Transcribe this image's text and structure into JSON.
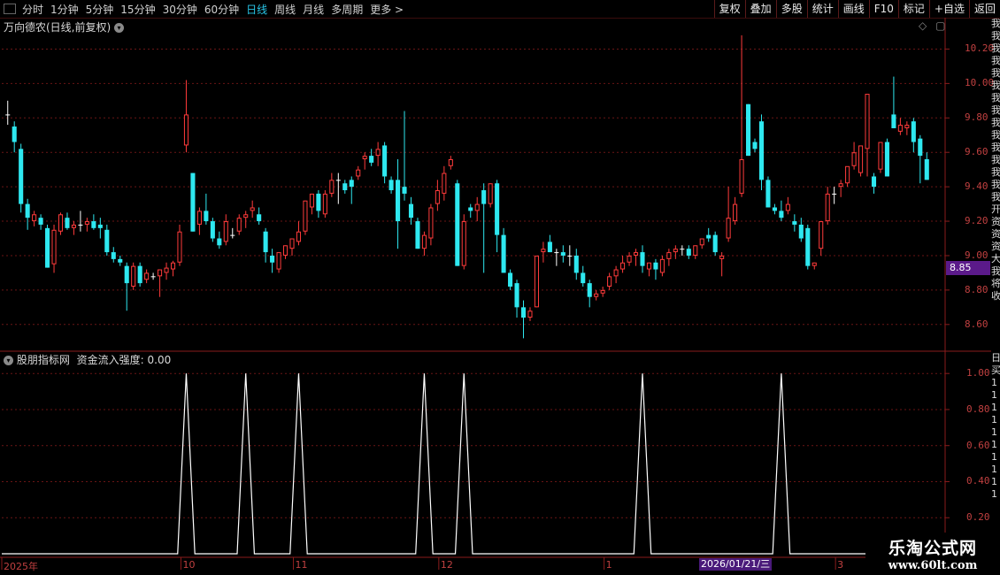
{
  "toolbar": {
    "periods": [
      "分时",
      "1分钟",
      "5分钟",
      "15分钟",
      "30分钟",
      "60分钟",
      "日线",
      "周线",
      "月线",
      "多周期",
      "更多 >"
    ],
    "active_period": "日线",
    "tools": [
      "复权",
      "叠加",
      "多股",
      "统计",
      "画线",
      "F10",
      "标记",
      "+自选",
      "返回"
    ]
  },
  "main_pane": {
    "title": "万向德农(日线,前复权)",
    "price_ticks": [
      "10.20",
      "10.00",
      "9.80",
      "9.60",
      "9.40",
      "9.20",
      "9.00",
      "8.80",
      "8.60"
    ],
    "current_price_tag": "8.85",
    "right_strip_chars": [
      "我",
      "我",
      "我",
      "我",
      "我",
      "我",
      "我",
      "我",
      "我",
      "我",
      "我",
      "我",
      "我",
      "我",
      "我",
      "开",
      "资",
      "资",
      "资",
      "大",
      "我",
      "将",
      "收"
    ]
  },
  "indicator_pane": {
    "title": "股朋指标网",
    "metric_label": "资金流入强度:",
    "metric_value": "0.00",
    "ticks": [
      "1.00",
      "0.80",
      "0.60",
      "0.40",
      "0.20"
    ],
    "right_strip_chars": [
      "日",
      "买",
      "1",
      "1",
      "1",
      "1",
      "1",
      "1",
      "1",
      "1",
      "1",
      "1"
    ]
  },
  "date_axis": {
    "labels": [
      "2025年",
      "10",
      "11",
      "12",
      "1",
      "3"
    ],
    "cursor_date": "2026/01/21/三"
  },
  "watermark": {
    "title": "乐淘公式网",
    "url": "www.60lt.com"
  },
  "colors": {
    "up": "#ff3b3b",
    "down": "#2ee8f0",
    "flat": "#ffffff",
    "grid": "#6a1515",
    "axis_text": "#c04040",
    "active_tab": "#29c6e8",
    "price_tag_bg": "#5b1a8a"
  },
  "chart_data": [
    {
      "type": "candlestick",
      "title": "万向德农(日线,前复权)",
      "ylim": [
        8.45,
        10.3
      ],
      "y_ticks": [
        8.6,
        8.8,
        9.0,
        9.2,
        9.4,
        9.6,
        9.8,
        10.0,
        10.2
      ],
      "x_axis_labels": [
        "2025年",
        "10",
        "11",
        "12",
        "1",
        "3"
      ],
      "ohlc": [
        [
          9.82,
          9.9,
          9.76,
          9.82
        ],
        [
          9.75,
          9.78,
          9.6,
          9.66
        ],
        [
          9.62,
          9.65,
          9.25,
          9.3
        ],
        [
          9.3,
          9.33,
          9.15,
          9.22
        ],
        [
          9.2,
          9.26,
          9.17,
          9.24
        ],
        [
          9.22,
          9.24,
          9.15,
          9.18
        ],
        [
          9.16,
          9.18,
          8.93,
          8.93
        ],
        [
          8.95,
          9.18,
          8.9,
          9.15
        ],
        [
          9.14,
          9.25,
          9.12,
          9.24
        ],
        [
          9.22,
          9.25,
          9.15,
          9.16
        ],
        [
          9.16,
          9.2,
          9.12,
          9.18
        ],
        [
          9.18,
          9.26,
          9.14,
          9.18
        ],
        [
          9.18,
          9.22,
          9.14,
          9.2
        ],
        [
          9.2,
          9.24,
          9.15,
          9.16
        ],
        [
          9.18,
          9.22,
          9.1,
          9.16
        ],
        [
          9.15,
          9.18,
          9.0,
          9.02
        ],
        [
          9.02,
          9.05,
          8.96,
          8.98
        ],
        [
          8.98,
          9.0,
          8.94,
          8.96
        ],
        [
          8.94,
          8.96,
          8.68,
          8.84
        ],
        [
          8.82,
          8.96,
          8.8,
          8.94
        ],
        [
          8.94,
          8.96,
          8.82,
          8.84
        ],
        [
          8.86,
          8.92,
          8.84,
          8.9
        ],
        [
          8.88,
          8.9,
          8.86,
          8.88
        ],
        [
          8.88,
          8.92,
          8.76,
          8.92
        ],
        [
          8.9,
          8.96,
          8.86,
          8.93
        ],
        [
          8.92,
          8.97,
          8.88,
          8.96
        ],
        [
          8.96,
          9.18,
          8.94,
          9.14
        ],
        [
          9.64,
          10.02,
          9.6,
          9.82
        ],
        [
          9.48,
          9.48,
          9.14,
          9.14
        ],
        [
          9.18,
          9.28,
          9.12,
          9.26
        ],
        [
          9.26,
          9.36,
          9.18,
          9.2
        ],
        [
          9.2,
          9.22,
          9.08,
          9.1
        ],
        [
          9.1,
          9.14,
          9.04,
          9.06
        ],
        [
          9.08,
          9.24,
          9.06,
          9.2
        ],
        [
          9.12,
          9.16,
          9.1,
          9.12
        ],
        [
          9.14,
          9.24,
          9.12,
          9.22
        ],
        [
          9.22,
          9.26,
          9.16,
          9.24
        ],
        [
          9.26,
          9.32,
          9.22,
          9.28
        ],
        [
          9.24,
          9.28,
          9.18,
          9.2
        ],
        [
          9.14,
          9.16,
          8.96,
          9.02
        ],
        [
          9.0,
          9.04,
          8.9,
          8.96
        ],
        [
          8.92,
          9.0,
          8.9,
          9.02
        ],
        [
          9.0,
          9.06,
          8.98,
          9.06
        ],
        [
          9.04,
          9.1,
          9.0,
          9.1
        ],
        [
          9.08,
          9.2,
          9.06,
          9.14
        ],
        [
          9.14,
          9.32,
          9.12,
          9.32
        ],
        [
          9.28,
          9.36,
          9.24,
          9.36
        ],
        [
          9.36,
          9.38,
          9.22,
          9.26
        ],
        [
          9.24,
          9.38,
          9.22,
          9.36
        ],
        [
          9.36,
          9.48,
          9.34,
          9.44
        ],
        [
          9.44,
          9.48,
          9.3,
          9.44
        ],
        [
          9.42,
          9.44,
          9.36,
          9.38
        ],
        [
          9.44,
          9.46,
          9.3,
          9.4
        ],
        [
          9.46,
          9.52,
          9.44,
          9.5
        ],
        [
          9.56,
          9.6,
          9.5,
          9.58
        ],
        [
          9.58,
          9.62,
          9.52,
          9.54
        ],
        [
          9.58,
          9.66,
          9.52,
          9.62
        ],
        [
          9.64,
          9.66,
          9.42,
          9.46
        ],
        [
          9.44,
          9.46,
          9.36,
          9.38
        ],
        [
          9.44,
          9.56,
          9.04,
          9.2
        ],
        [
          9.4,
          9.84,
          9.32,
          9.36
        ],
        [
          9.3,
          9.34,
          9.18,
          9.22
        ],
        [
          9.2,
          9.22,
          9.04,
          9.04
        ],
        [
          9.04,
          9.14,
          9.0,
          9.12
        ],
        [
          9.1,
          9.3,
          9.06,
          9.28
        ],
        [
          9.3,
          9.44,
          9.26,
          9.38
        ],
        [
          9.36,
          9.52,
          9.32,
          9.48
        ],
        [
          9.52,
          9.58,
          9.5,
          9.56
        ],
        [
          9.42,
          9.44,
          8.94,
          8.94
        ],
        [
          8.94,
          9.24,
          8.92,
          9.2
        ],
        [
          9.28,
          9.3,
          9.22,
          9.26
        ],
        [
          9.26,
          9.34,
          9.2,
          9.3
        ],
        [
          9.38,
          9.42,
          8.9,
          9.3
        ],
        [
          9.3,
          9.42,
          9.28,
          9.42
        ],
        [
          9.42,
          9.44,
          9.02,
          9.12
        ],
        [
          9.12,
          9.16,
          8.9,
          8.9
        ],
        [
          8.9,
          8.92,
          8.8,
          8.82
        ],
        [
          8.84,
          8.86,
          8.64,
          8.7
        ],
        [
          8.7,
          8.74,
          8.52,
          8.64
        ],
        [
          8.64,
          8.7,
          8.62,
          8.68
        ],
        [
          8.7,
          8.9,
          8.7,
          9.0
        ],
        [
          9.02,
          9.08,
          8.96,
          9.04
        ],
        [
          9.08,
          9.12,
          9.02,
          9.02
        ],
        [
          9.02,
          9.04,
          8.94,
          9.02
        ],
        [
          9.02,
          9.06,
          8.96,
          9.0
        ],
        [
          9.0,
          9.06,
          8.94,
          9.0
        ],
        [
          9.0,
          9.04,
          8.86,
          8.9
        ],
        [
          8.9,
          8.94,
          8.82,
          8.84
        ],
        [
          8.84,
          8.86,
          8.7,
          8.76
        ],
        [
          8.76,
          8.8,
          8.74,
          8.78
        ],
        [
          8.78,
          8.82,
          8.76,
          8.8
        ],
        [
          8.82,
          8.9,
          8.8,
          8.88
        ],
        [
          8.88,
          8.94,
          8.84,
          8.92
        ],
        [
          8.92,
          9.0,
          8.9,
          8.96
        ],
        [
          8.96,
          9.02,
          8.94,
          9.0
        ],
        [
          9.0,
          9.04,
          8.94,
          9.02
        ],
        [
          9.02,
          9.06,
          8.9,
          8.94
        ],
        [
          8.92,
          8.96,
          8.88,
          8.96
        ],
        [
          8.96,
          8.98,
          8.86,
          8.92
        ],
        [
          8.9,
          9.0,
          8.88,
          8.98
        ],
        [
          8.98,
          9.04,
          8.94,
          9.02
        ],
        [
          9.02,
          9.06,
          8.98,
          9.04
        ],
        [
          9.04,
          9.06,
          9.0,
          9.04
        ],
        [
          9.04,
          9.06,
          8.98,
          9.0
        ],
        [
          9.0,
          9.06,
          8.98,
          9.06
        ],
        [
          9.06,
          9.1,
          9.04,
          9.1
        ],
        [
          9.12,
          9.16,
          9.08,
          9.1
        ],
        [
          9.12,
          9.14,
          9.0,
          9.02
        ],
        [
          8.98,
          9.02,
          8.88,
          9.0
        ],
        [
          9.1,
          9.4,
          9.08,
          9.22
        ],
        [
          9.2,
          9.34,
          9.18,
          9.3
        ],
        [
          9.36,
          10.28,
          9.34,
          9.56
        ],
        [
          9.88,
          9.88,
          9.58,
          9.58
        ],
        [
          9.66,
          9.68,
          9.6,
          9.62
        ],
        [
          9.78,
          9.82,
          9.38,
          9.44
        ],
        [
          9.44,
          9.46,
          9.28,
          9.28
        ],
        [
          9.28,
          9.3,
          9.24,
          9.26
        ],
        [
          9.26,
          9.32,
          9.2,
          9.22
        ],
        [
          9.26,
          9.34,
          9.24,
          9.3
        ],
        [
          9.2,
          9.24,
          9.14,
          9.18
        ],
        [
          9.18,
          9.22,
          9.08,
          9.1
        ],
        [
          9.16,
          9.18,
          8.92,
          8.94
        ],
        [
          8.94,
          8.96,
          8.92,
          8.96
        ],
        [
          9.04,
          9.16,
          9.0,
          9.2
        ],
        [
          9.2,
          9.4,
          9.18,
          9.36
        ],
        [
          9.36,
          9.4,
          9.3,
          9.36
        ],
        [
          9.4,
          9.44,
          9.34,
          9.42
        ],
        [
          9.42,
          9.46,
          9.4,
          9.52
        ],
        [
          9.52,
          9.66,
          9.5,
          9.6
        ],
        [
          9.48,
          9.6,
          9.46,
          9.64
        ],
        [
          9.62,
          9.92,
          9.46,
          9.94
        ],
        [
          9.46,
          9.48,
          9.36,
          9.4
        ],
        [
          9.5,
          9.58,
          9.48,
          9.66
        ],
        [
          9.66,
          9.68,
          9.46,
          9.46
        ],
        [
          9.82,
          10.04,
          9.76,
          9.74
        ],
        [
          9.72,
          9.8,
          9.7,
          9.76
        ],
        [
          9.74,
          9.78,
          9.7,
          9.76
        ],
        [
          9.78,
          9.8,
          9.6,
          9.66
        ],
        [
          9.68,
          9.7,
          9.42,
          9.58
        ],
        [
          9.56,
          9.6,
          9.44,
          9.44
        ]
      ]
    },
    {
      "type": "line",
      "title": "资金流入强度",
      "ylim": [
        0,
        1.05
      ],
      "y_ticks": [
        0.2,
        0.4,
        0.6,
        0.8,
        1.0
      ],
      "spike_bar_index": [
        27,
        36,
        44,
        63,
        69,
        96,
        117
      ],
      "spike_value": 1.0,
      "baseline_value": 0.0,
      "current_value": 0.0
    }
  ]
}
